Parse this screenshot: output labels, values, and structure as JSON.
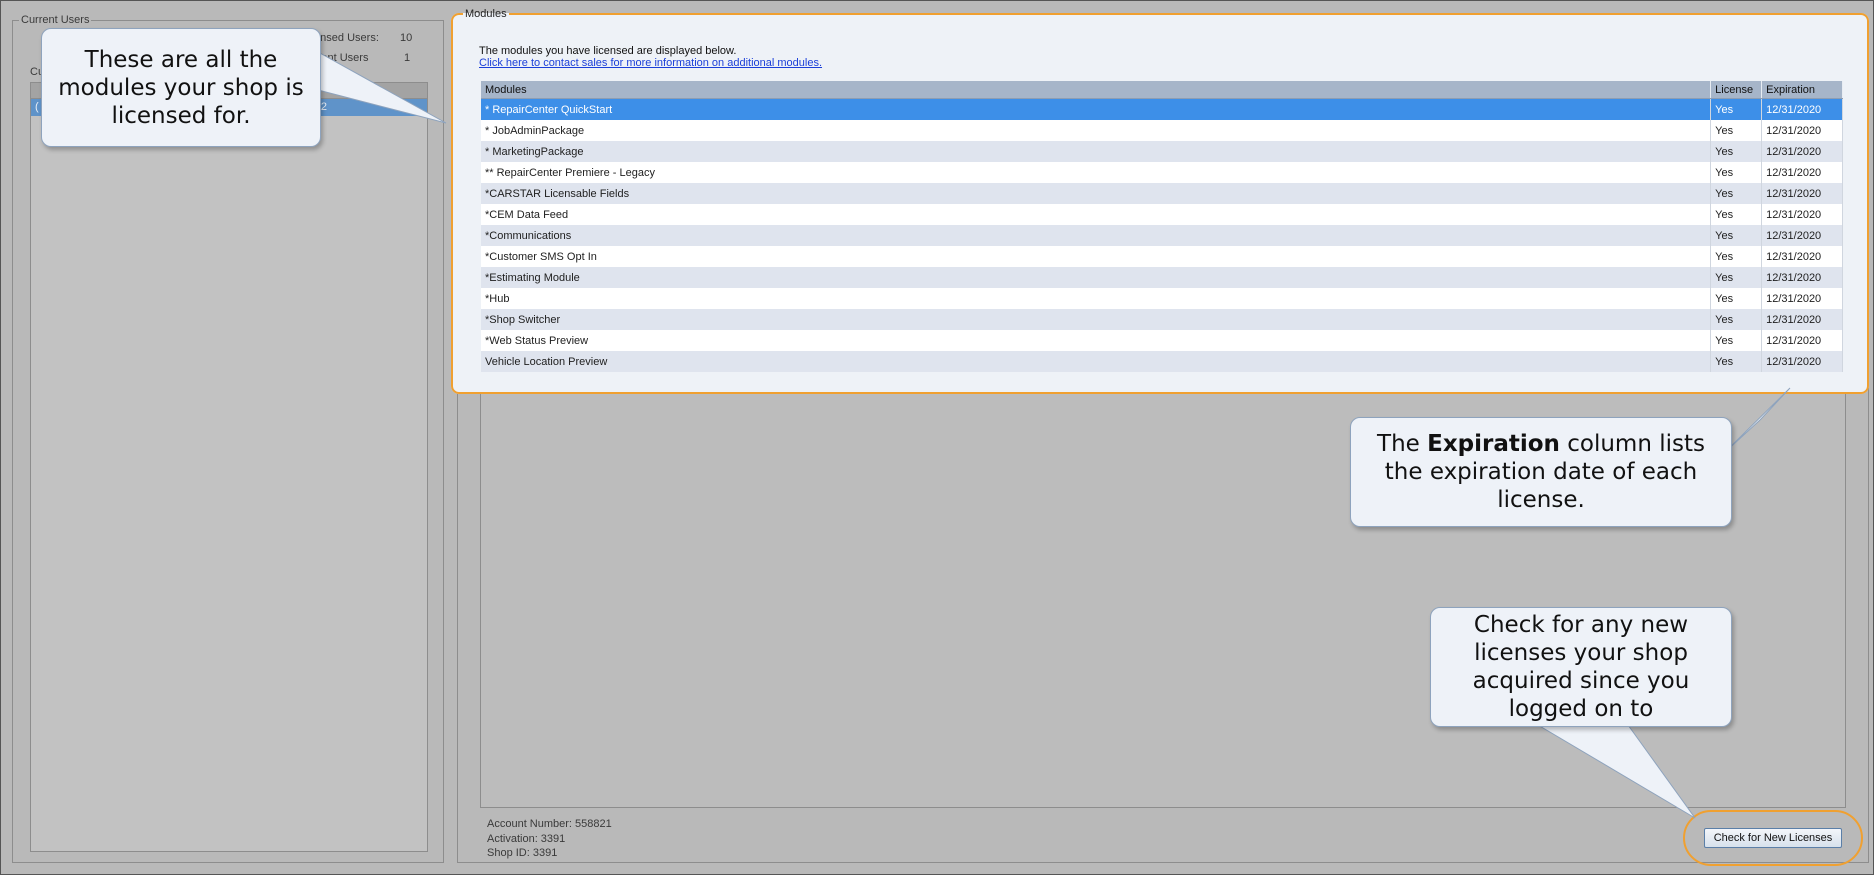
{
  "current_users": {
    "group_title": "Current Users",
    "licensed_users_label": "Licensed Users:",
    "licensed_users_value": "10",
    "current_users_label": "Current Users",
    "current_users_value": "1",
    "list_label": "Cu",
    "row_fragment_left": "(",
    "row_fragment_right": "2"
  },
  "modules": {
    "group_title": "Modules",
    "intro_text": "The modules you have licensed are displayed below.",
    "contact_link": "Click here to contact sales for more information on additional modules.",
    "columns": [
      "Modules",
      "License",
      "Expiration"
    ],
    "rows": [
      {
        "module": "*  RepairCenter QuickStart",
        "license": "Yes",
        "expiration": "12/31/2020",
        "selected": true
      },
      {
        "module": "* JobAdminPackage",
        "license": "Yes",
        "expiration": "12/31/2020"
      },
      {
        "module": "* MarketingPackage",
        "license": "Yes",
        "expiration": "12/31/2020"
      },
      {
        "module": "** RepairCenter Premiere - Legacy",
        "license": "Yes",
        "expiration": "12/31/2020"
      },
      {
        "module": "*CARSTAR Licensable Fields",
        "license": "Yes",
        "expiration": "12/31/2020"
      },
      {
        "module": "*CEM Data Feed",
        "license": "Yes",
        "expiration": "12/31/2020"
      },
      {
        "module": "*Communications",
        "license": "Yes",
        "expiration": "12/31/2020"
      },
      {
        "module": "*Customer SMS Opt In",
        "license": "Yes",
        "expiration": "12/31/2020"
      },
      {
        "module": "*Estimating Module",
        "license": "Yes",
        "expiration": "12/31/2020"
      },
      {
        "module": "*Hub",
        "license": "Yes",
        "expiration": "12/31/2020"
      },
      {
        "module": "*Shop Switcher",
        "license": "Yes",
        "expiration": "12/31/2020"
      },
      {
        "module": "*Web Status Preview",
        "license": "Yes",
        "expiration": "12/31/2020"
      },
      {
        "module": "Vehicle Location Preview",
        "license": "Yes",
        "expiration": "12/31/2020"
      }
    ]
  },
  "account": {
    "account_number": "Account Number: 558821",
    "activation": "Activation: 3391",
    "shop_id": "Shop ID: 3391"
  },
  "check_button_label": "Check for New Licenses",
  "callouts": {
    "modules": "These are all the modules your shop is licensed for.",
    "expiration_prefix": "The ",
    "expiration_bold": "Expiration",
    "expiration_suffix": " column lists the expiration date of each license.",
    "check": "Check for any new licenses your shop acquired since you logged on to"
  },
  "colors": {
    "highlight": "#f0a030",
    "selected_row": "#3d8fe8",
    "header": "#a6b5c9",
    "link": "#1b3fd9"
  }
}
